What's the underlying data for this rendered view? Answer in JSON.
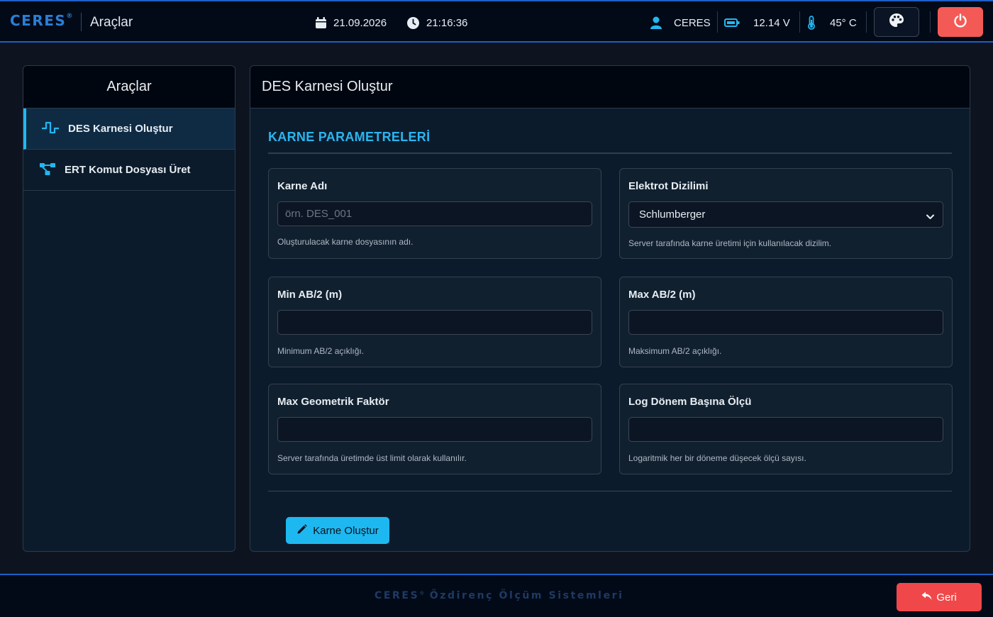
{
  "header": {
    "brand": "CERES",
    "brand_mark": "®",
    "section_title": "Araçlar",
    "date": "21.09.2026",
    "time": "21:16:36",
    "user": "CERES",
    "voltage": "12.14 V",
    "temperature": "45° C",
    "icons": {
      "date": "calendar-icon",
      "time": "clock-icon",
      "user": "user-icon",
      "voltage": "battery-icon",
      "temperature": "thermometer-icon",
      "theme": "palette-icon",
      "power": "power-icon"
    },
    "colors": {
      "brand": "#2a7fd6",
      "accent_border": "#1e5fc8",
      "power_button": "#f45a55"
    }
  },
  "sidebar": {
    "title": "Araçlar",
    "items": [
      {
        "label": "DES Karnesi Oluştur",
        "icon": "waveform-icon",
        "active": true
      },
      {
        "label": "ERT Komut Dosyası Üret",
        "icon": "nodes-icon",
        "active": false
      }
    ]
  },
  "main": {
    "title": "DES Karnesi Oluştur",
    "section_label": "KARNE PARAMETRELERİ",
    "fields": {
      "karne_adi": {
        "label": "Karne Adı",
        "placeholder": "örn. DES_001",
        "value": "",
        "help": "Oluşturulacak karne dosyasının adı."
      },
      "elektrot_dizilimi": {
        "label": "Elektrot Dizilimi",
        "selected": "Schlumberger",
        "help": "Server tarafında karne üretimi için kullanılacak dizilim."
      },
      "min_ab2": {
        "label": "Min AB/2 (m)",
        "value": "",
        "help": "Minimum AB/2 açıklığı."
      },
      "max_ab2": {
        "label": "Max AB/2 (m)",
        "value": "",
        "help": "Maksimum AB/2 açıklığı."
      },
      "max_geo": {
        "label": "Max Geometrik Faktör",
        "value": "",
        "help": "Server tarafında üretimde üst limit olarak kullanılır."
      },
      "log_donem": {
        "label": "Log Dönem Başına Ölçü",
        "value": "",
        "help": "Logaritmik her bir döneme düşecek ölçü sayısı."
      }
    },
    "submit_label": "Karne Oluştur",
    "submit_icon": "pencil-icon",
    "colors": {
      "accent": "#1eb8f0"
    }
  },
  "footer": {
    "brand": "CERES",
    "brand_mark": "®",
    "tagline": "Özdirenç Ölçüm Sistemleri",
    "back_label": "Geri",
    "back_icon": "reply-icon",
    "colors": {
      "back_button": "#f0484a"
    }
  }
}
